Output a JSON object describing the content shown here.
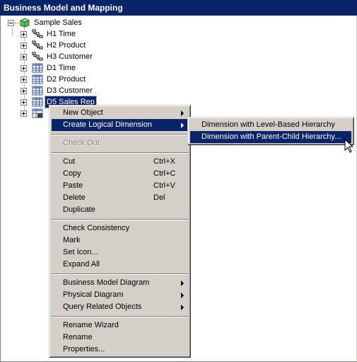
{
  "window": {
    "title": "Business Model and Mapping"
  },
  "tree": {
    "root": {
      "label": "Sample Sales",
      "icon": "business-model-cube-icon"
    },
    "items": [
      {
        "label": "H1 Time",
        "icon": "hierarchy-icon"
      },
      {
        "label": "H2 Product",
        "icon": "hierarchy-icon"
      },
      {
        "label": "H3 Customer",
        "icon": "hierarchy-icon"
      },
      {
        "label": "D1 Time",
        "icon": "table-icon"
      },
      {
        "label": "D2 Product",
        "icon": "table-icon"
      },
      {
        "label": "D3 Customer",
        "icon": "table-icon"
      },
      {
        "label": "D5 Sales Rep",
        "icon": "table-icon",
        "selected": true
      },
      {
        "label": "",
        "icon": "fact-table-icon"
      }
    ]
  },
  "context_menu": {
    "new_object": "New Object",
    "create_logical_dimension": "Create Logical Dimension",
    "check_out": "Check Out",
    "cut": "Cut",
    "cut_shortcut": "Ctrl+X",
    "copy": "Copy",
    "copy_shortcut": "Ctrl+C",
    "paste": "Paste",
    "paste_shortcut": "Ctrl+V",
    "delete": "Delete",
    "delete_shortcut": "Del",
    "duplicate": "Duplicate",
    "check_consistency": "Check Consistency",
    "mark": "Mark",
    "set_icon": "Set Icon...",
    "expand_all": "Expand All",
    "business_model_diagram": "Business Model Diagram",
    "physical_diagram": "Physical Diagram",
    "query_related_objects": "Query Related Objects",
    "rename_wizard": "Rename Wizard",
    "rename": "Rename",
    "properties": "Properties..."
  },
  "submenu": {
    "level_based": "Dimension with Level-Based Hierarchy",
    "parent_child": "Dimension with Parent-Child Hierarchy..."
  },
  "colors": {
    "selection": "#0a246a",
    "menu_face": "#d4d0c8"
  }
}
